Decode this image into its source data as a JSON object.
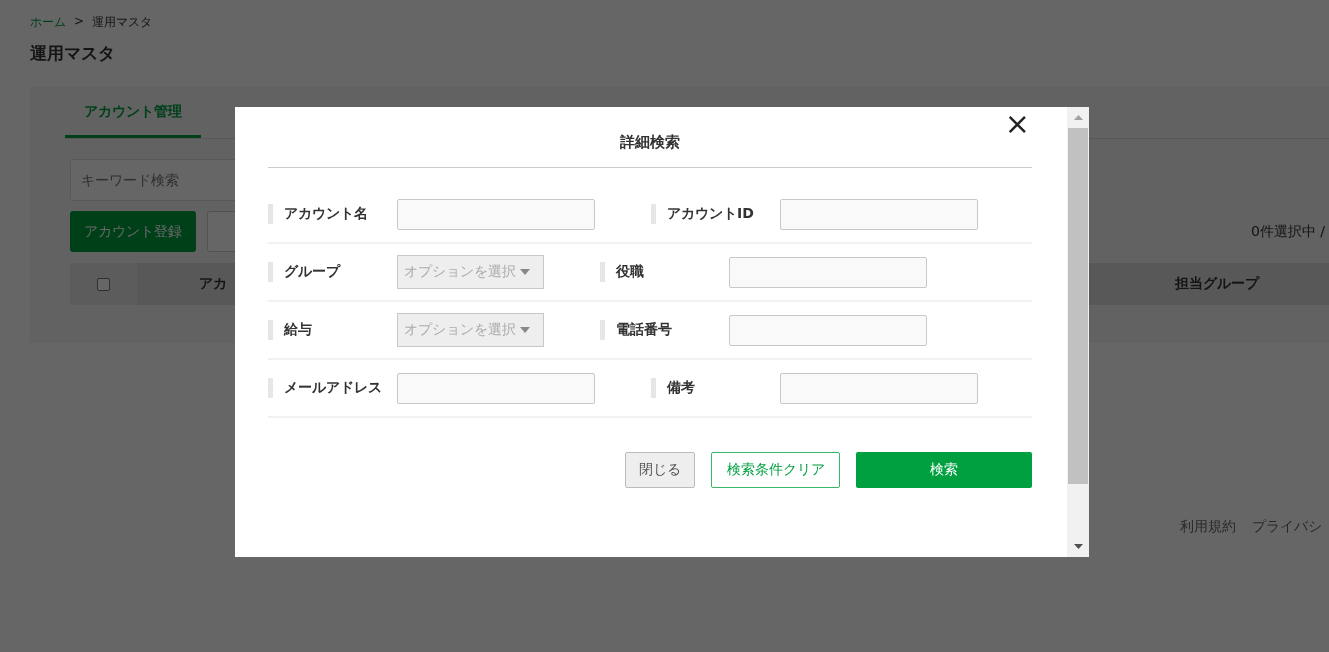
{
  "breadcrumb": [
    {
      "label": "ホーム",
      "link": true
    },
    {
      "label": "運用マスタ",
      "link": false
    }
  ],
  "breadcrumb_separator": ">",
  "page_title": "運用マスタ",
  "tabs": [
    {
      "label": "アカウント管理",
      "selected": true
    }
  ],
  "keyword_search": {
    "placeholder": "キーワード検索"
  },
  "register_button": "アカウント登録",
  "selection_count": "0件選択中 /",
  "table": {
    "select_all": {
      "checked": false
    },
    "columns": [
      "アカ",
      "担当グループ"
    ]
  },
  "footer_links": [
    "利用規約",
    "プライバシ"
  ],
  "dialog": {
    "title": "詳細検索",
    "close": "×",
    "rows": [
      {
        "left": {
          "label": "アカウント名",
          "kind": "text"
        },
        "right": {
          "label": "アカウントID",
          "kind": "text"
        }
      },
      {
        "left": {
          "label": "グループ",
          "kind": "select",
          "placeholder": "オプションを選択"
        },
        "right": {
          "label": "役職",
          "kind": "text"
        }
      },
      {
        "left": {
          "label": "給与",
          "kind": "select",
          "placeholder": "オプションを選択"
        },
        "right": {
          "label": "電話番号",
          "kind": "text"
        }
      },
      {
        "left": {
          "label": "メールアドレス",
          "kind": "text"
        },
        "right": {
          "label": "備考",
          "kind": "text"
        }
      }
    ],
    "buttons": [
      {
        "label": "閉じる",
        "kind": "secondary"
      },
      {
        "label": "検索条件クリア",
        "kind": "outline"
      },
      {
        "label": "検索",
        "kind": "primary"
      }
    ]
  }
}
